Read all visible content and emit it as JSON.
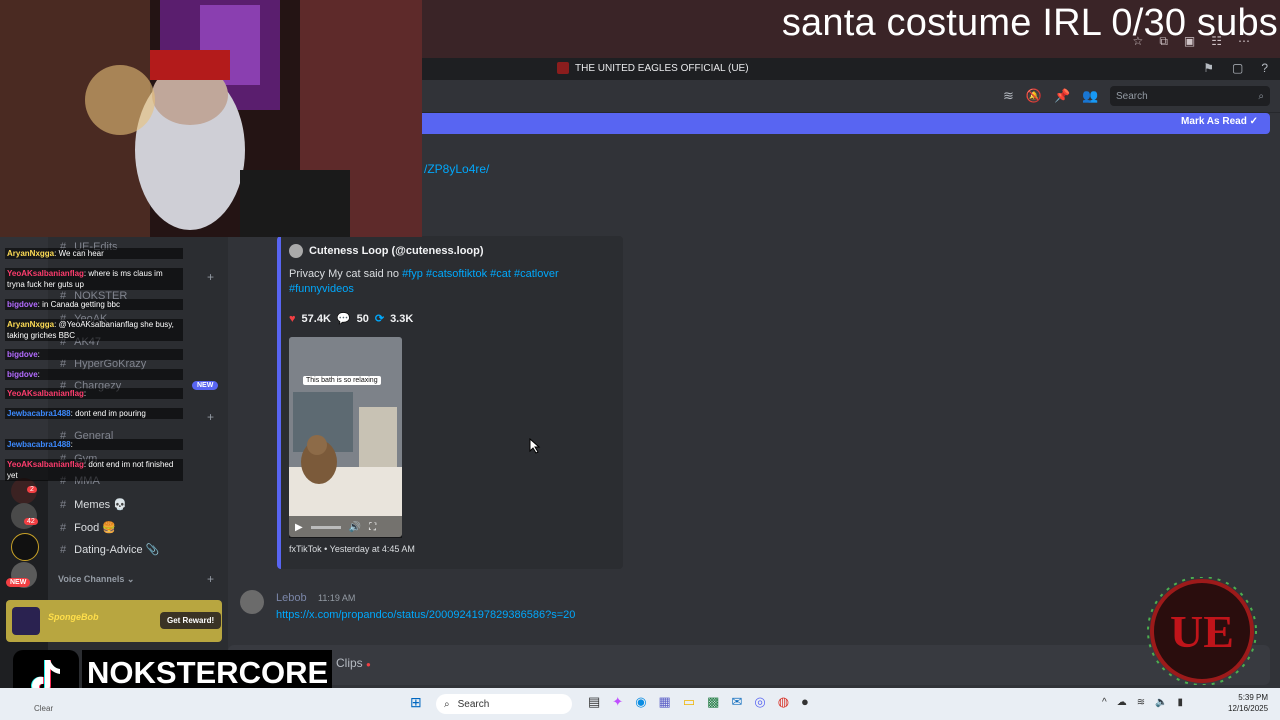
{
  "overlay": {
    "title": "santa costume IRL 0/30 subs"
  },
  "discord": {
    "server_name": "THE UNITED EAGLES OFFICIAL (UE)",
    "search_placeholder": "Search",
    "new_messages_bar": {
      "mark_read_label": "Mark As Read"
    },
    "partial_link": "/ZP8yLo4re/",
    "embed": {
      "author": "Cuteness Loop (@cuteness.loop)",
      "description_text": "Privacy My cat said no ",
      "hashtags": [
        "#fyp",
        "#catsoftiktok",
        "#cat",
        "#catlover",
        "#funnyvideos"
      ],
      "stats": {
        "likes": "57.4K",
        "comments": "50",
        "shares": "3.3K"
      },
      "video_caption": "This bath is so relaxing",
      "footer": "fxTikTok • Yesterday at 4:45 AM"
    },
    "message2": {
      "author": "Lebob",
      "time": "11:19 AM",
      "link": "https://x.com/propandco/status/2000924197829386586?s=20"
    },
    "input_partial": "Clips",
    "channels": [
      {
        "name": "UE-Edits"
      },
      {
        "name": "NOKSTER"
      },
      {
        "name": "YeoAK"
      },
      {
        "name": "AK47"
      },
      {
        "name": "HyperGoKrazy"
      },
      {
        "name": "Chargezy"
      },
      {
        "name": "General"
      },
      {
        "name": "Gym"
      },
      {
        "name": "MMA"
      },
      {
        "name": "Memes"
      },
      {
        "name": "Food"
      },
      {
        "name": "Dating-Advice"
      }
    ],
    "new_pill": "NEW",
    "voice_channels_header": "Voice Channels",
    "rail_badges": {
      "badge_a": "2",
      "badge_b": "42",
      "new": "NEW"
    }
  },
  "stream_chat": [
    {
      "user": "AryanNxgga",
      "text": "We can hear"
    },
    {
      "user": "YeoAKsalbanianflag",
      "text": "where is ms claus im tryna fuck her guts up"
    },
    {
      "user": "bigdove",
      "text": "in Canada getting bbc"
    },
    {
      "user": "AryanNxgga",
      "text": "@YeoAKsalbanianflag she busy, taking griches BBC"
    },
    {
      "user": "bigdove",
      "text": ""
    },
    {
      "user": "bigdove",
      "text": ""
    },
    {
      "user": "YeoAKsalbanianflag",
      "text": ""
    },
    {
      "user": "Jewbacabra1488",
      "text": "dont end im pouring"
    },
    {
      "user": "Jewbacabra1488",
      "text": ""
    },
    {
      "user": "YeoAKsalbanianflag",
      "text": "dont end im not finished yet"
    }
  ],
  "reward_banner": {
    "game": "SpongeBob",
    "button": "Get Reward!"
  },
  "tiktok": {
    "name": "NOKSTERCORE"
  },
  "taskbar": {
    "search": "Search",
    "time": "5:39 PM",
    "date": "12/16/2025",
    "weather": "Clear"
  },
  "logo": {
    "text": "UE"
  },
  "colors": {
    "blurple": "#5865f2",
    "link": "#00a8fc",
    "bg": "#313338"
  }
}
